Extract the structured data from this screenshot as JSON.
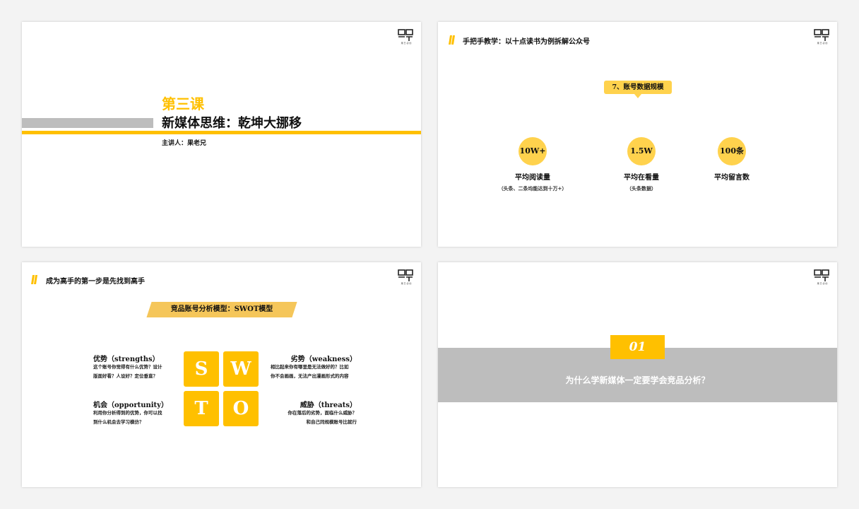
{
  "logo": {
    "caption": "果 已 初 创"
  },
  "slide1": {
    "lesson": "第三课",
    "title": "新媒体思维：乾坤大挪移",
    "speaker": "主讲人：果老兄"
  },
  "slide2": {
    "header": "手把手教学：以十点读书为例拆解公众号",
    "bubble": "7、账号数据规模",
    "stats": [
      {
        "value": "10W+",
        "label": "平均阅读量",
        "note": "（头条、二条均能达到十万+）"
      },
      {
        "value": "1.5W",
        "label": "平均在看量",
        "note": "（头条数据）"
      },
      {
        "value": "100条",
        "label": "平均留言数",
        "note": ""
      }
    ]
  },
  "slide3": {
    "header": "成为高手的第一步是先找到高手",
    "banner": "竞品账号分析模型：SWOT模型",
    "tiles": [
      "S",
      "W",
      "T",
      "O"
    ],
    "strengths": {
      "title": "优势（strengths）",
      "line1": "这个账号你觉得有什么优势？设计",
      "line2": "版面好看？人设好？定位垂直？"
    },
    "weakness": {
      "title": "劣势（weakness）",
      "line1": "相比起来你有哪里是无法做好的？比如",
      "line2": "你不会画画，无法产出漫画形式的内容"
    },
    "opportunity": {
      "title": "机会（opportunity）",
      "line1": "利用你分析得到的优势，你可以找",
      "line2": "到什么机会去学习模仿？"
    },
    "threats": {
      "title": "威胁（threats）",
      "line1": "你在落后的劣势，面临什么威胁？",
      "line2": "和自己同规模账号比就行"
    }
  },
  "slide4": {
    "number": "01",
    "question": "为什么学新媒体一定要学会竞品分析？"
  },
  "colors": {
    "accent": "#ffc000",
    "gray": "#bdbdbd"
  }
}
